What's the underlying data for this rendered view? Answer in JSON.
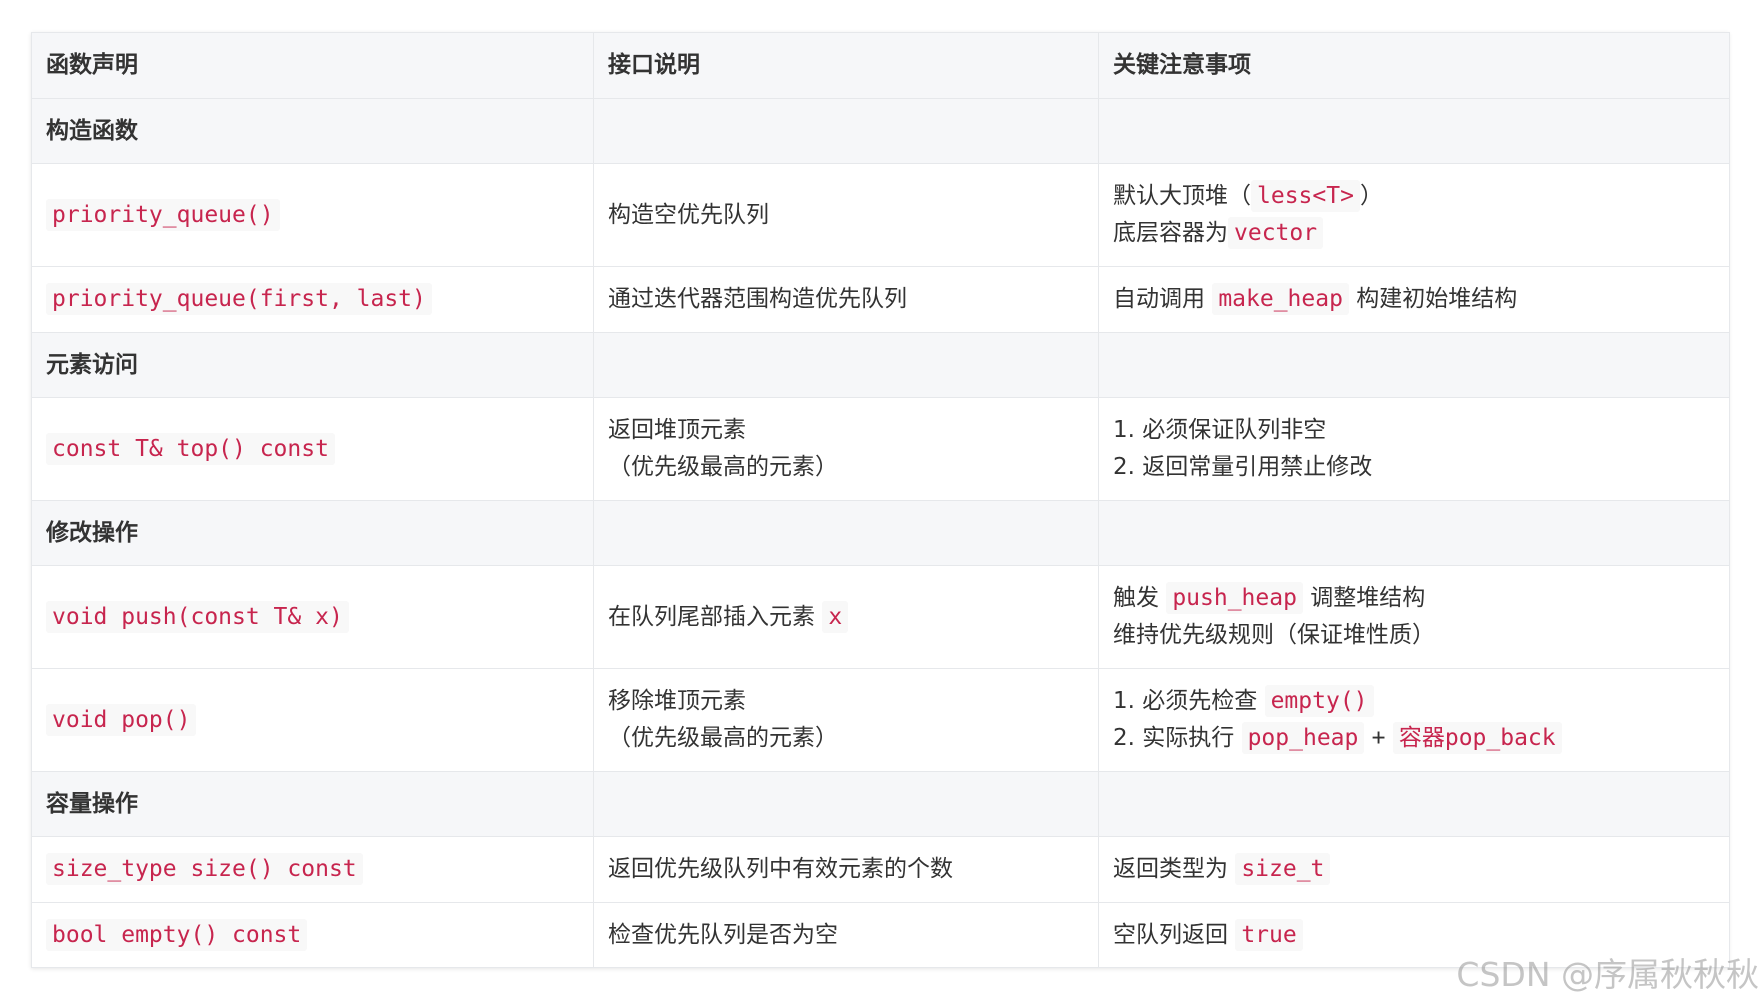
{
  "headers": [
    "函数声明",
    "接口说明",
    "关键注意事项"
  ],
  "sections": {
    "construct": "构造函数",
    "access": "元素访问",
    "modify": "修改操作",
    "capacity": "容量操作"
  },
  "rows": {
    "ctor_default": {
      "func": "priority_queue()",
      "desc": "构造空优先队列",
      "note1_pre": "默认大顶堆（",
      "note1_code": "less<T>",
      "note1_post": "）",
      "note2_pre": "底层容器为",
      "note2_code": "vector"
    },
    "ctor_range": {
      "func": "priority_queue(first, last)",
      "desc": "通过迭代器范围构造优先队列",
      "note_pre": "自动调用",
      "note_code": "make_heap",
      "note_post": "构建初始堆结构"
    },
    "top": {
      "func": "const T& top() const",
      "desc1": "返回堆顶元素",
      "desc2": "（优先级最高的元素）",
      "note1": "1. 必须保证队列非空",
      "note2": "2. 返回常量引用禁止修改"
    },
    "push": {
      "func": "void push(const T& x)",
      "desc_pre": "在队列尾部插入元素",
      "desc_code": "x",
      "note1_pre": "触发",
      "note1_code": "push_heap",
      "note1_post": "调整堆结构",
      "note2": "维持优先级规则（保证堆性质）"
    },
    "pop": {
      "func": "void pop()",
      "desc1": "移除堆顶元素",
      "desc2": "（优先级最高的元素）",
      "note1_pre": "1. 必须先检查",
      "note1_code": "empty()",
      "note2_pre": "2. 实际执行",
      "note2_code1": "pop_heap",
      "note2_plus": "+",
      "note2_code2": "容器pop_back"
    },
    "size": {
      "func": "size_type size() const",
      "desc": "返回优先级队列中有效元素的个数",
      "note_pre": "返回类型为",
      "note_code": "size_t"
    },
    "empty": {
      "func": "bool empty() const",
      "desc": "检查优先队列是否为空",
      "note_pre": "空队列返回",
      "note_code": "true"
    }
  },
  "watermark": "CSDN @序属秋秋秋"
}
